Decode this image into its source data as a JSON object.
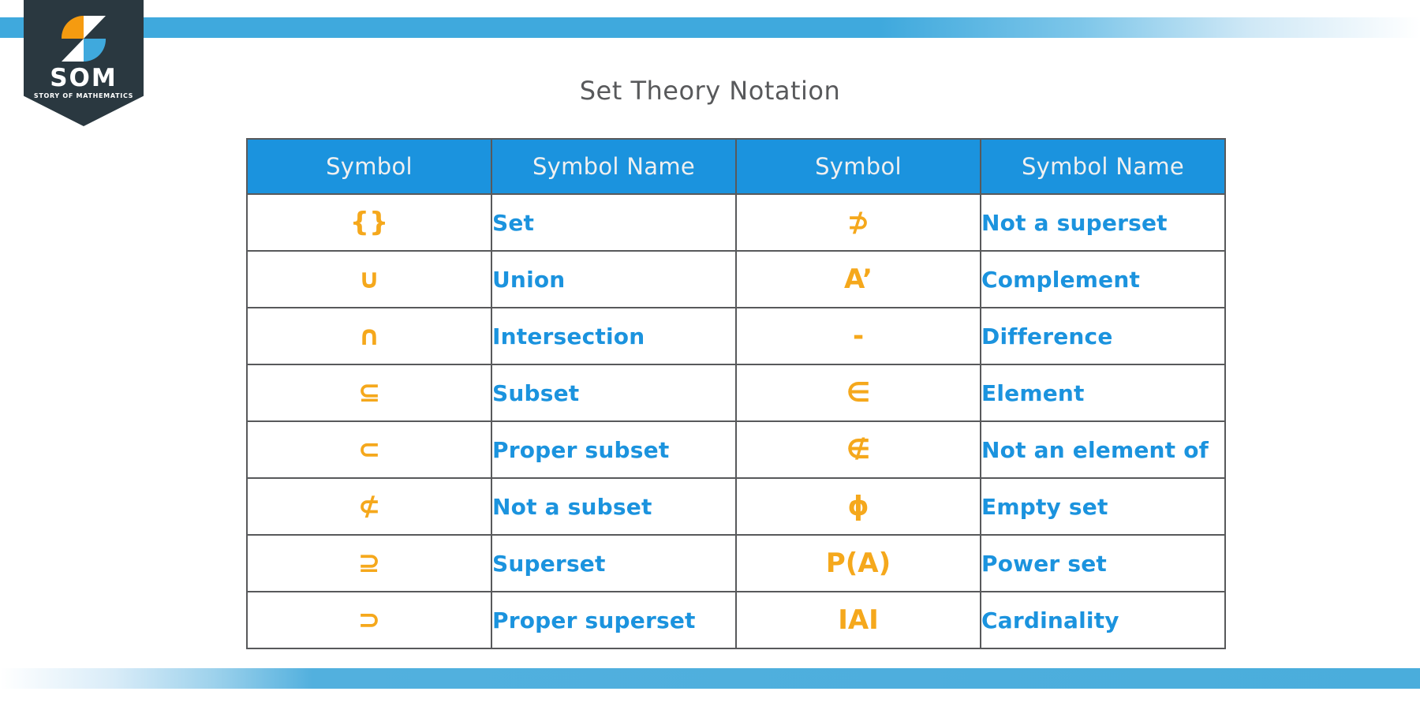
{
  "brand": {
    "logo_name": "SOM",
    "logo_tagline": "STORY OF MATHEMATICS",
    "badge_color": "#2a3840",
    "accent_orange": "#f5a81c",
    "accent_blue": "#1b93de",
    "band_blue": "#4aaddc"
  },
  "page": {
    "title": "Set Theory Notation",
    "title_color": "#58595b",
    "background": "#ffffff"
  },
  "table": {
    "border_color": "#58595b",
    "header_bg": "#1b93de",
    "header_text_color": "#f0f0f0",
    "symbol_color": "#f5a81c",
    "name_color": "#1b93de",
    "headers": [
      "Symbol",
      "Symbol Name",
      "Symbol",
      "Symbol Name"
    ],
    "rows": [
      {
        "symbol_left": "{}",
        "name_left": "Set",
        "symbol_right": "⊅",
        "name_right": "Not a superset"
      },
      {
        "symbol_left": "∪",
        "name_left": "Union",
        "symbol_right": "A’",
        "name_right": "Complement"
      },
      {
        "symbol_left": "∩",
        "name_left": "Intersection",
        "symbol_right": "-",
        "name_right": "Difference"
      },
      {
        "symbol_left": "⊆",
        "name_left": "Subset",
        "symbol_right": "∈",
        "name_right": "Element"
      },
      {
        "symbol_left": "⊂",
        "name_left": "Proper subset",
        "symbol_right": "∉",
        "name_right": "Not an element of"
      },
      {
        "symbol_left": "⊄",
        "name_left": "Not a subset",
        "symbol_right": "ϕ",
        "name_right": "Empty set"
      },
      {
        "symbol_left": "⊇",
        "name_left": "Superset",
        "symbol_right": "P(A)",
        "name_right": "Power set"
      },
      {
        "symbol_left": "⊃",
        "name_left": "Proper superset",
        "symbol_right": "IAI",
        "name_right": "Cardinality"
      }
    ]
  }
}
